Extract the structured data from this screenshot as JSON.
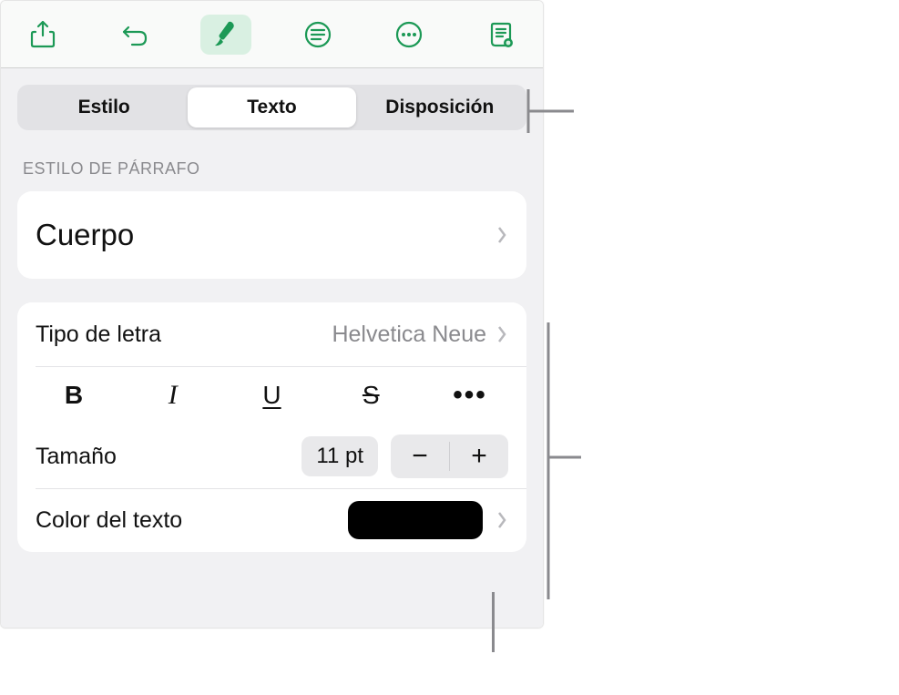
{
  "toolbar": {
    "icons": [
      "share-icon",
      "undo-icon",
      "format-brush-icon",
      "text-settings-icon",
      "more-icon",
      "reading-view-icon"
    ]
  },
  "tabs": {
    "style": "Estilo",
    "text": "Texto",
    "layout": "Disposición",
    "selected": "text"
  },
  "paragraph_style": {
    "header": "Estilo de párrafo",
    "current": "Cuerpo"
  },
  "font": {
    "label": "Tipo de letra",
    "value": "Helvetica Neue"
  },
  "format_buttons": {
    "bold": "B",
    "italic": "I",
    "underline": "U",
    "strike": "S",
    "more": "•••"
  },
  "size": {
    "label": "Tamaño",
    "value": "11 pt",
    "minus": "−",
    "plus": "+"
  },
  "text_color": {
    "label": "Color del texto",
    "swatch": "#000000"
  }
}
